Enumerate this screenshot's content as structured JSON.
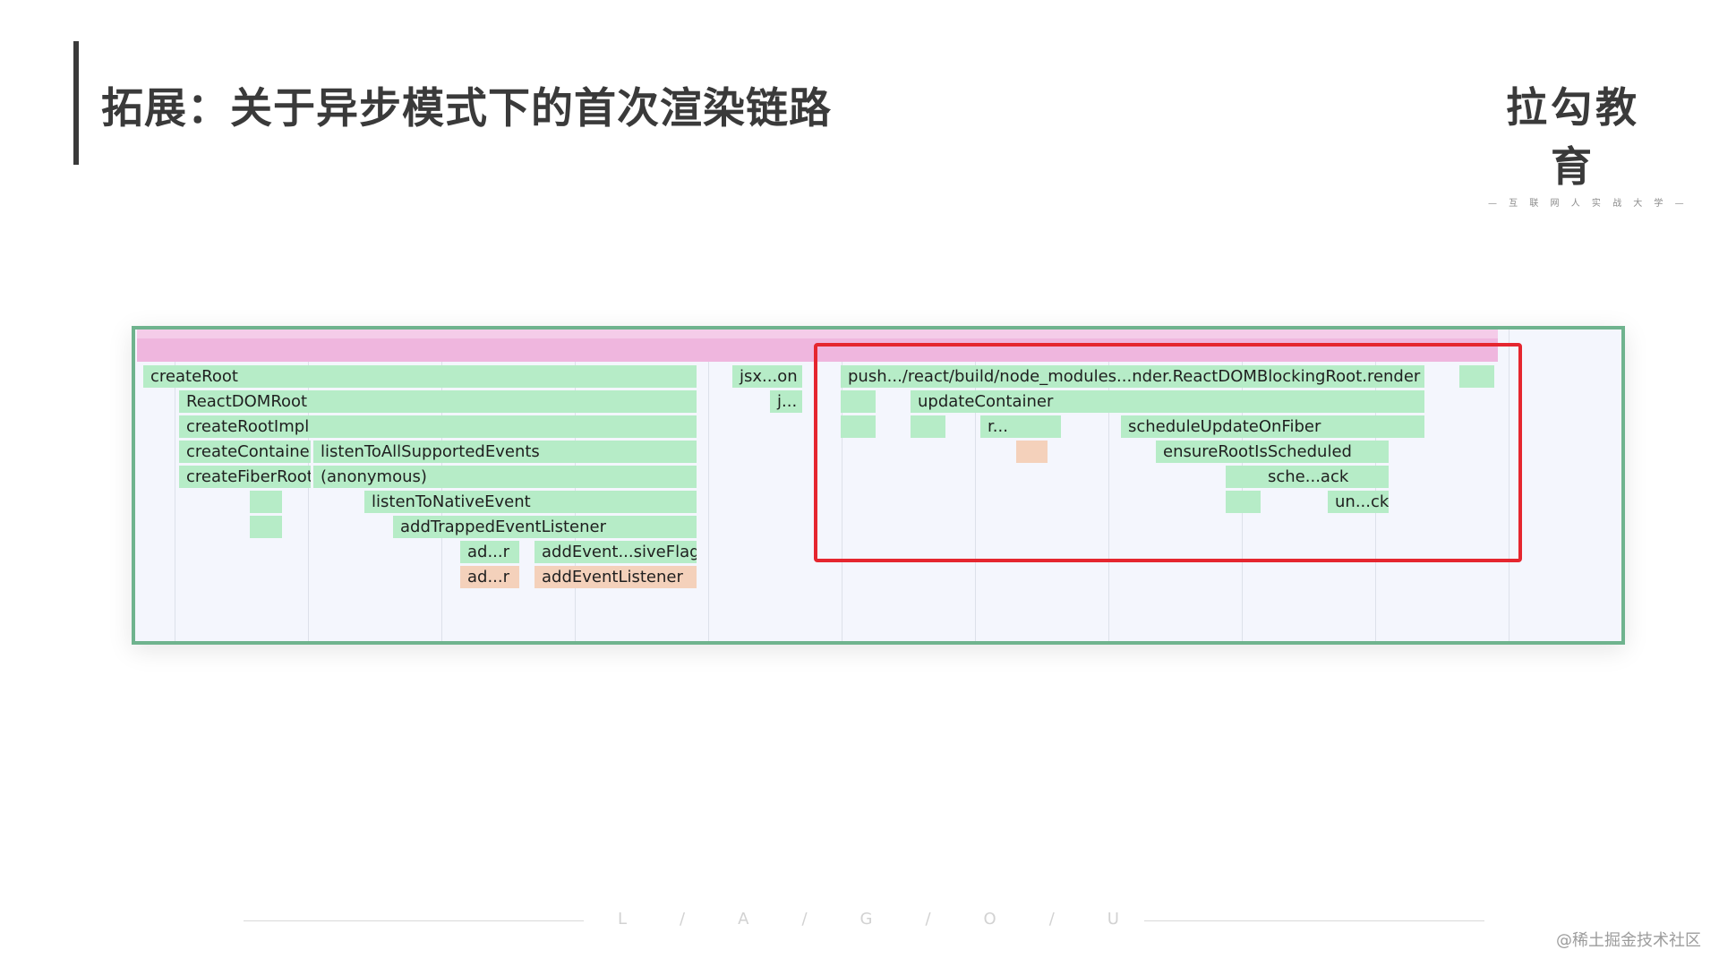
{
  "slide": {
    "title": "拓展：关于异步模式下的首次渲染链路"
  },
  "logo": {
    "name": "拉勾教育",
    "tagline": "— 互 联 网 人 实 战 大 学 —"
  },
  "flame_graph": {
    "frames": {
      "createRoot": "createRoot",
      "ReactDOMRoot": "ReactDOMRoot",
      "createRootImpl": "createRootImpl",
      "createContainer": "createContainer",
      "listenToAllSupportedEvents": "listenToAllSupportedEvents",
      "createFiberRoot": "createFiberRoot",
      "anonymous": "(anonymous)",
      "listenToNativeEvent": "listenToNativeEvent",
      "addTrappedEventListener": "addTrappedEventListener",
      "ad_r_1": "ad...r",
      "addEvent_siveFlag": "addEvent...siveFlag",
      "ad_r_2": "ad...r",
      "addEventListener": "addEventListener",
      "jsx_on": "jsx...on",
      "j_dots": "j...",
      "push_render": "push.../react/build/node_modules...nder.ReactDOMBlockingRoot.render",
      "updateContainer": "updateContainer",
      "r_dots": "r...",
      "scheduleUpdateOnFiber": "scheduleUpdateOnFiber",
      "ensureRootIsScheduled": "ensureRootIsScheduled",
      "sche_ack": "sche...ack",
      "un_ck": "un...ck"
    },
    "colors": {
      "frame": "#b6ecc7",
      "frame_peach": "#f4d1bb",
      "top_bar": "#efb6de",
      "border": "#6fb38e",
      "highlight": "#e5262f"
    }
  },
  "footer": {
    "letters": [
      "L",
      "/",
      "A",
      "/",
      "G",
      "/",
      "O",
      "/",
      "U"
    ],
    "watermark": "@稀土掘金技术社区"
  }
}
